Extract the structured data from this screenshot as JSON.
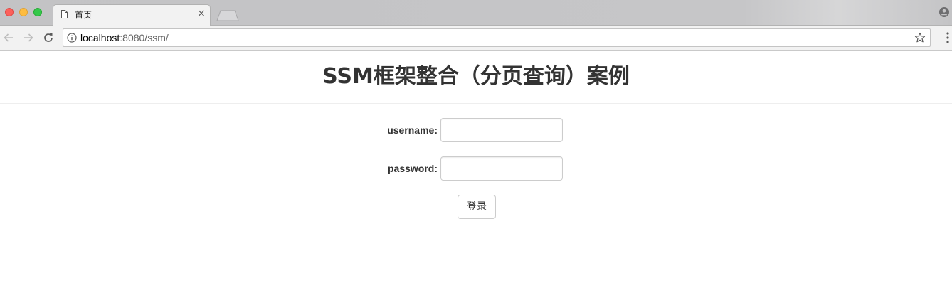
{
  "browser": {
    "tab": {
      "title": "首页",
      "icon": "document-icon",
      "close_glyph": "×"
    },
    "address_bar": {
      "host": "localhost",
      "path": ":8080/ssm/",
      "security_icon": "info-icon"
    },
    "toolbar_icons": [
      "back-arrow-icon",
      "forward-arrow-icon",
      "reload-icon",
      "star-icon",
      "menu-icon"
    ],
    "traffic_light_colors": {
      "close": "#fc605b",
      "minimize": "#fdbc40",
      "maximize": "#34c84a"
    }
  },
  "page": {
    "title": "SSM框架整合（分页查询）案例",
    "form": {
      "username_label": "username:",
      "username_value": "",
      "password_label": "password:",
      "password_value": "",
      "submit_label": "登录"
    }
  }
}
